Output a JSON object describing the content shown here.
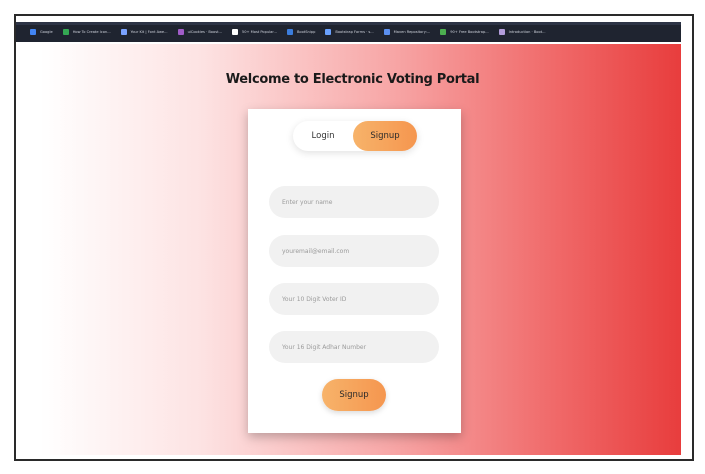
{
  "bookmarks": [
    {
      "label": "Google",
      "color": "#4285f4"
    },
    {
      "label": "How To Create Icon...",
      "color": "#34a853"
    },
    {
      "label": "Your Kit | Font Awe...",
      "color": "#7aa2ff"
    },
    {
      "label": "uiCookies · Boost...",
      "color": "#a05cc8"
    },
    {
      "label": "50+ Most Popular...",
      "color": "#ffffff"
    },
    {
      "label": "BootSnipp",
      "color": "#3b7ddd"
    },
    {
      "label": "Bootstrap Forms · s...",
      "color": "#6aa1ff"
    },
    {
      "label": "Maven Repository:...",
      "color": "#5b8ff0"
    },
    {
      "label": "90+ Free Bootstrap...",
      "color": "#4caf50"
    },
    {
      "label": "Introduction · Boot...",
      "color": "#b39ddb"
    }
  ],
  "page": {
    "title": "Welcome to Electronic Voting Portal"
  },
  "form": {
    "tabs": {
      "login": "Login",
      "signup": "Signup"
    },
    "active_tab": "signup",
    "fields": {
      "name_placeholder": "Enter your name",
      "email_placeholder": "youremail@email.com",
      "voter_placeholder": "Your 10 Digit Voter ID",
      "adhar_placeholder": "Your 16 Digit Adhar Number"
    },
    "submit_label": "Signup"
  }
}
